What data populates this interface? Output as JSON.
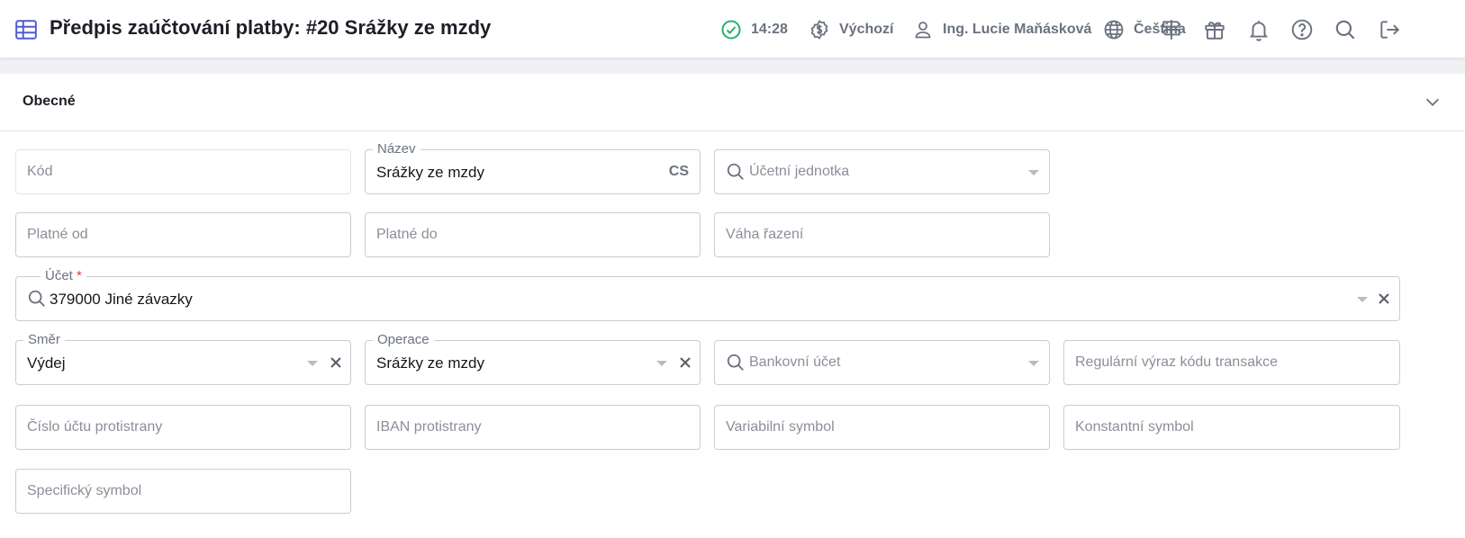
{
  "header": {
    "title": "Předpis zaúčtování platby: #20 Srážky ze mzdy",
    "time": "14:28",
    "currency_profile": "Výchozí",
    "user": "Ing. Lucie Maňásková",
    "language": "Čeština",
    "icons": [
      "table-icon",
      "check-circle-icon",
      "currency-icon",
      "user-icon",
      "globe-icon",
      "signpost-icon",
      "gift-icon",
      "bell-icon",
      "help-icon",
      "search-icon",
      "logout-icon"
    ]
  },
  "section": {
    "title": "Obecné"
  },
  "form": {
    "kod": {
      "placeholder": "Kód"
    },
    "nazev": {
      "label": "Název",
      "value": "Srážky ze mzdy",
      "lang": "CS"
    },
    "ucetni_jednotka": {
      "placeholder": "Účetní jednotka"
    },
    "platne_od": {
      "placeholder": "Platné od"
    },
    "platne_do": {
      "placeholder": "Platné do"
    },
    "vaha_razeni": {
      "placeholder": "Váha řazení"
    },
    "ucet": {
      "label": "Účet",
      "required_mark": "*",
      "value": "379000 Jiné závazky"
    },
    "smer": {
      "label": "Směr",
      "value": "Výdej"
    },
    "operace": {
      "label": "Operace",
      "value": "Srážky ze mzdy"
    },
    "bankovni_ucet": {
      "placeholder": "Bankovní účet"
    },
    "regex_kod": {
      "placeholder": "Regulární výraz kódu transakce"
    },
    "cislo_uctu_protistrany": {
      "placeholder": "Číslo účtu protistrany"
    },
    "iban_protistrany": {
      "placeholder": "IBAN protistrany"
    },
    "variabilni_symbol": {
      "placeholder": "Variabilní symbol"
    },
    "konstantni_symbol": {
      "placeholder": "Konstantní symbol"
    },
    "specificky_symbol": {
      "placeholder": "Specifický symbol"
    }
  },
  "colors": {
    "accent": "#4f5bd5",
    "success": "#21b36b",
    "required": "#e23b3b"
  }
}
